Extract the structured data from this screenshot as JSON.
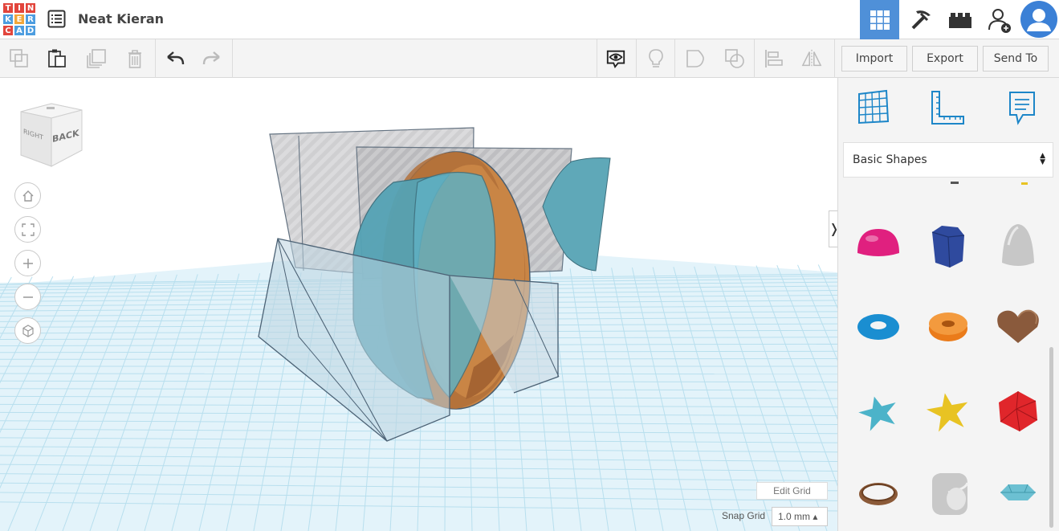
{
  "app": {
    "logo_letters": [
      "T",
      "I",
      "N",
      "K",
      "E",
      "R",
      "C",
      "A",
      "D"
    ],
    "logo_colors": [
      "#e2453c",
      "#e2453c",
      "#e2453c",
      "#4d9de0",
      "#f2a73b",
      "#4d9de0",
      "#e2453c",
      "#4d9de0",
      "#4d9de0"
    ],
    "design_title": "Neat Kieran"
  },
  "topbar": {
    "buttons": [
      {
        "name": "3d-design-view",
        "icon": "grid-icon",
        "active": true
      },
      {
        "name": "codeblocks",
        "icon": "pickaxe-icon",
        "active": false
      },
      {
        "name": "bricks",
        "icon": "brick-icon",
        "active": false
      },
      {
        "name": "add-user",
        "icon": "add-user-icon",
        "active": false
      }
    ],
    "accent": "#4f90d8"
  },
  "toolbar": {
    "import_label": "Import",
    "export_label": "Export",
    "send_to_label": "Send To"
  },
  "viewcube": {
    "face_front": "BACK",
    "face_side": "RIGHT"
  },
  "workplane": {
    "edit_grid_label": "Edit Grid",
    "snap_grid_label": "Snap Grid",
    "snap_grid_value": "1.0 mm ▴",
    "grid_color": "#b8dfee"
  },
  "sidebar": {
    "category": "Basic Shapes",
    "shapes": [
      {
        "name": "half-sphere",
        "color": "#e0207f"
      },
      {
        "name": "polygon",
        "color": "#2f4a9e"
      },
      {
        "name": "paraboloid",
        "color": "#c7c7c7"
      },
      {
        "name": "torus",
        "color": "#1a8ed1"
      },
      {
        "name": "tube",
        "color": "#ea7b1a"
      },
      {
        "name": "heart",
        "color": "#8a5a3c"
      },
      {
        "name": "star",
        "color": "#4cb3c9"
      },
      {
        "name": "star-gold",
        "color": "#e8c323"
      },
      {
        "name": "icosahedron",
        "color": "#e0262b"
      },
      {
        "name": "ring",
        "color": "#8b5a38"
      },
      {
        "name": "rounded-cube",
        "color": "#c8c8c8"
      },
      {
        "name": "diamond",
        "color": "#6cc0d2"
      }
    ]
  }
}
